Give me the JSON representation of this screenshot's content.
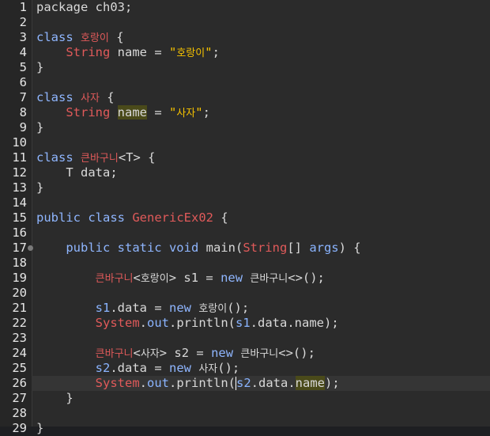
{
  "lines": [
    {
      "n": "1",
      "tokens": [
        {
          "t": "package ch03;",
          "c": "plain"
        }
      ]
    },
    {
      "n": "2",
      "tokens": []
    },
    {
      "n": "3",
      "tokens": [
        {
          "t": "class ",
          "c": "kw"
        },
        {
          "t": "호랑이",
          "c": "type",
          "ko": true
        },
        {
          "t": " {",
          "c": "plain"
        }
      ]
    },
    {
      "n": "4",
      "tokens": [
        {
          "t": "    ",
          "c": "plain"
        },
        {
          "t": "String",
          "c": "type"
        },
        {
          "t": " name = ",
          "c": "plain"
        },
        {
          "t": "\"",
          "c": "str"
        },
        {
          "t": "호랑이",
          "c": "str",
          "ko": true
        },
        {
          "t": "\"",
          "c": "str"
        },
        {
          "t": ";",
          "c": "plain"
        }
      ]
    },
    {
      "n": "5",
      "tokens": [
        {
          "t": "}",
          "c": "plain"
        }
      ]
    },
    {
      "n": "6",
      "tokens": []
    },
    {
      "n": "7",
      "tokens": [
        {
          "t": "class ",
          "c": "kw"
        },
        {
          "t": "사자",
          "c": "type",
          "ko": true
        },
        {
          "t": " {",
          "c": "plain"
        }
      ]
    },
    {
      "n": "8",
      "tokens": [
        {
          "t": "    ",
          "c": "plain"
        },
        {
          "t": "String",
          "c": "type"
        },
        {
          "t": " ",
          "c": "plain"
        },
        {
          "t": "name",
          "c": "plain",
          "mark": true
        },
        {
          "t": " = ",
          "c": "plain"
        },
        {
          "t": "\"",
          "c": "str"
        },
        {
          "t": "사자",
          "c": "str",
          "ko": true
        },
        {
          "t": "\"",
          "c": "str"
        },
        {
          "t": ";",
          "c": "plain"
        }
      ]
    },
    {
      "n": "9",
      "tokens": [
        {
          "t": "}",
          "c": "plain"
        }
      ]
    },
    {
      "n": "10",
      "tokens": []
    },
    {
      "n": "11",
      "tokens": [
        {
          "t": "class ",
          "c": "kw"
        },
        {
          "t": "큰바구니",
          "c": "type",
          "ko": true
        },
        {
          "t": "<T> {",
          "c": "plain"
        }
      ]
    },
    {
      "n": "12",
      "tokens": [
        {
          "t": "    T data;",
          "c": "plain"
        }
      ]
    },
    {
      "n": "13",
      "tokens": [
        {
          "t": "}",
          "c": "plain"
        }
      ]
    },
    {
      "n": "14",
      "tokens": []
    },
    {
      "n": "15",
      "tokens": [
        {
          "t": "public class ",
          "c": "kw"
        },
        {
          "t": "GenericEx02",
          "c": "type"
        },
        {
          "t": " {",
          "c": "plain"
        }
      ]
    },
    {
      "n": "16",
      "tokens": []
    },
    {
      "n": "17",
      "fold": true,
      "tokens": [
        {
          "t": "    public static void ",
          "c": "kw"
        },
        {
          "t": "main(",
          "c": "plain"
        },
        {
          "t": "String",
          "c": "type"
        },
        {
          "t": "[] ",
          "c": "plain"
        },
        {
          "t": "args",
          "c": "var"
        },
        {
          "t": ") {",
          "c": "plain"
        }
      ]
    },
    {
      "n": "18",
      "tokens": []
    },
    {
      "n": "19",
      "tokens": [
        {
          "t": "        ",
          "c": "plain"
        },
        {
          "t": "큰바구니",
          "c": "type",
          "ko": true
        },
        {
          "t": "<",
          "c": "plain"
        },
        {
          "t": "호랑이",
          "c": "plain",
          "ko": true
        },
        {
          "t": "> s1 = ",
          "c": "plain"
        },
        {
          "t": "new ",
          "c": "kw"
        },
        {
          "t": "큰바구니",
          "c": "plain",
          "ko": true
        },
        {
          "t": "<>();",
          "c": "plain"
        }
      ]
    },
    {
      "n": "20",
      "tokens": []
    },
    {
      "n": "21",
      "tokens": [
        {
          "t": "        ",
          "c": "plain"
        },
        {
          "t": "s1",
          "c": "var"
        },
        {
          "t": ".data = ",
          "c": "plain"
        },
        {
          "t": "new ",
          "c": "kw"
        },
        {
          "t": "호랑이",
          "c": "plain",
          "ko": true
        },
        {
          "t": "();",
          "c": "plain"
        }
      ]
    },
    {
      "n": "22",
      "tokens": [
        {
          "t": "        ",
          "c": "plain"
        },
        {
          "t": "System",
          "c": "type"
        },
        {
          "t": ".",
          "c": "plain"
        },
        {
          "t": "out",
          "c": "var"
        },
        {
          "t": ".println(",
          "c": "plain"
        },
        {
          "t": "s1",
          "c": "var"
        },
        {
          "t": ".data.name);",
          "c": "plain"
        }
      ]
    },
    {
      "n": "23",
      "tokens": []
    },
    {
      "n": "24",
      "tokens": [
        {
          "t": "        ",
          "c": "plain"
        },
        {
          "t": "큰바구니",
          "c": "type",
          "ko": true
        },
        {
          "t": "<",
          "c": "plain"
        },
        {
          "t": "사자",
          "c": "plain",
          "ko": true
        },
        {
          "t": "> s2 = ",
          "c": "plain"
        },
        {
          "t": "new ",
          "c": "kw"
        },
        {
          "t": "큰바구니",
          "c": "plain",
          "ko": true
        },
        {
          "t": "<>();",
          "c": "plain"
        }
      ]
    },
    {
      "n": "25",
      "tokens": [
        {
          "t": "        ",
          "c": "plain"
        },
        {
          "t": "s2",
          "c": "var"
        },
        {
          "t": ".data = ",
          "c": "plain"
        },
        {
          "t": "new ",
          "c": "kw"
        },
        {
          "t": "사자",
          "c": "plain",
          "ko": true
        },
        {
          "t": "();",
          "c": "plain"
        }
      ]
    },
    {
      "n": "26",
      "current": true,
      "tokens": [
        {
          "t": "        ",
          "c": "plain"
        },
        {
          "t": "System",
          "c": "type"
        },
        {
          "t": ".",
          "c": "plain"
        },
        {
          "t": "out",
          "c": "var"
        },
        {
          "t": ".println(",
          "c": "plain"
        },
        {
          "caret": true
        },
        {
          "t": "s2",
          "c": "var"
        },
        {
          "t": ".data.",
          "c": "plain"
        },
        {
          "t": "name",
          "c": "plain",
          "mark": true
        },
        {
          "t": ");",
          "c": "plain"
        }
      ]
    },
    {
      "n": "27",
      "tokens": [
        {
          "t": "    }",
          "c": "plain"
        }
      ]
    },
    {
      "n": "28",
      "tokens": []
    },
    {
      "n": "29",
      "tokens": [
        {
          "t": "}",
          "c": "plain"
        }
      ]
    }
  ]
}
